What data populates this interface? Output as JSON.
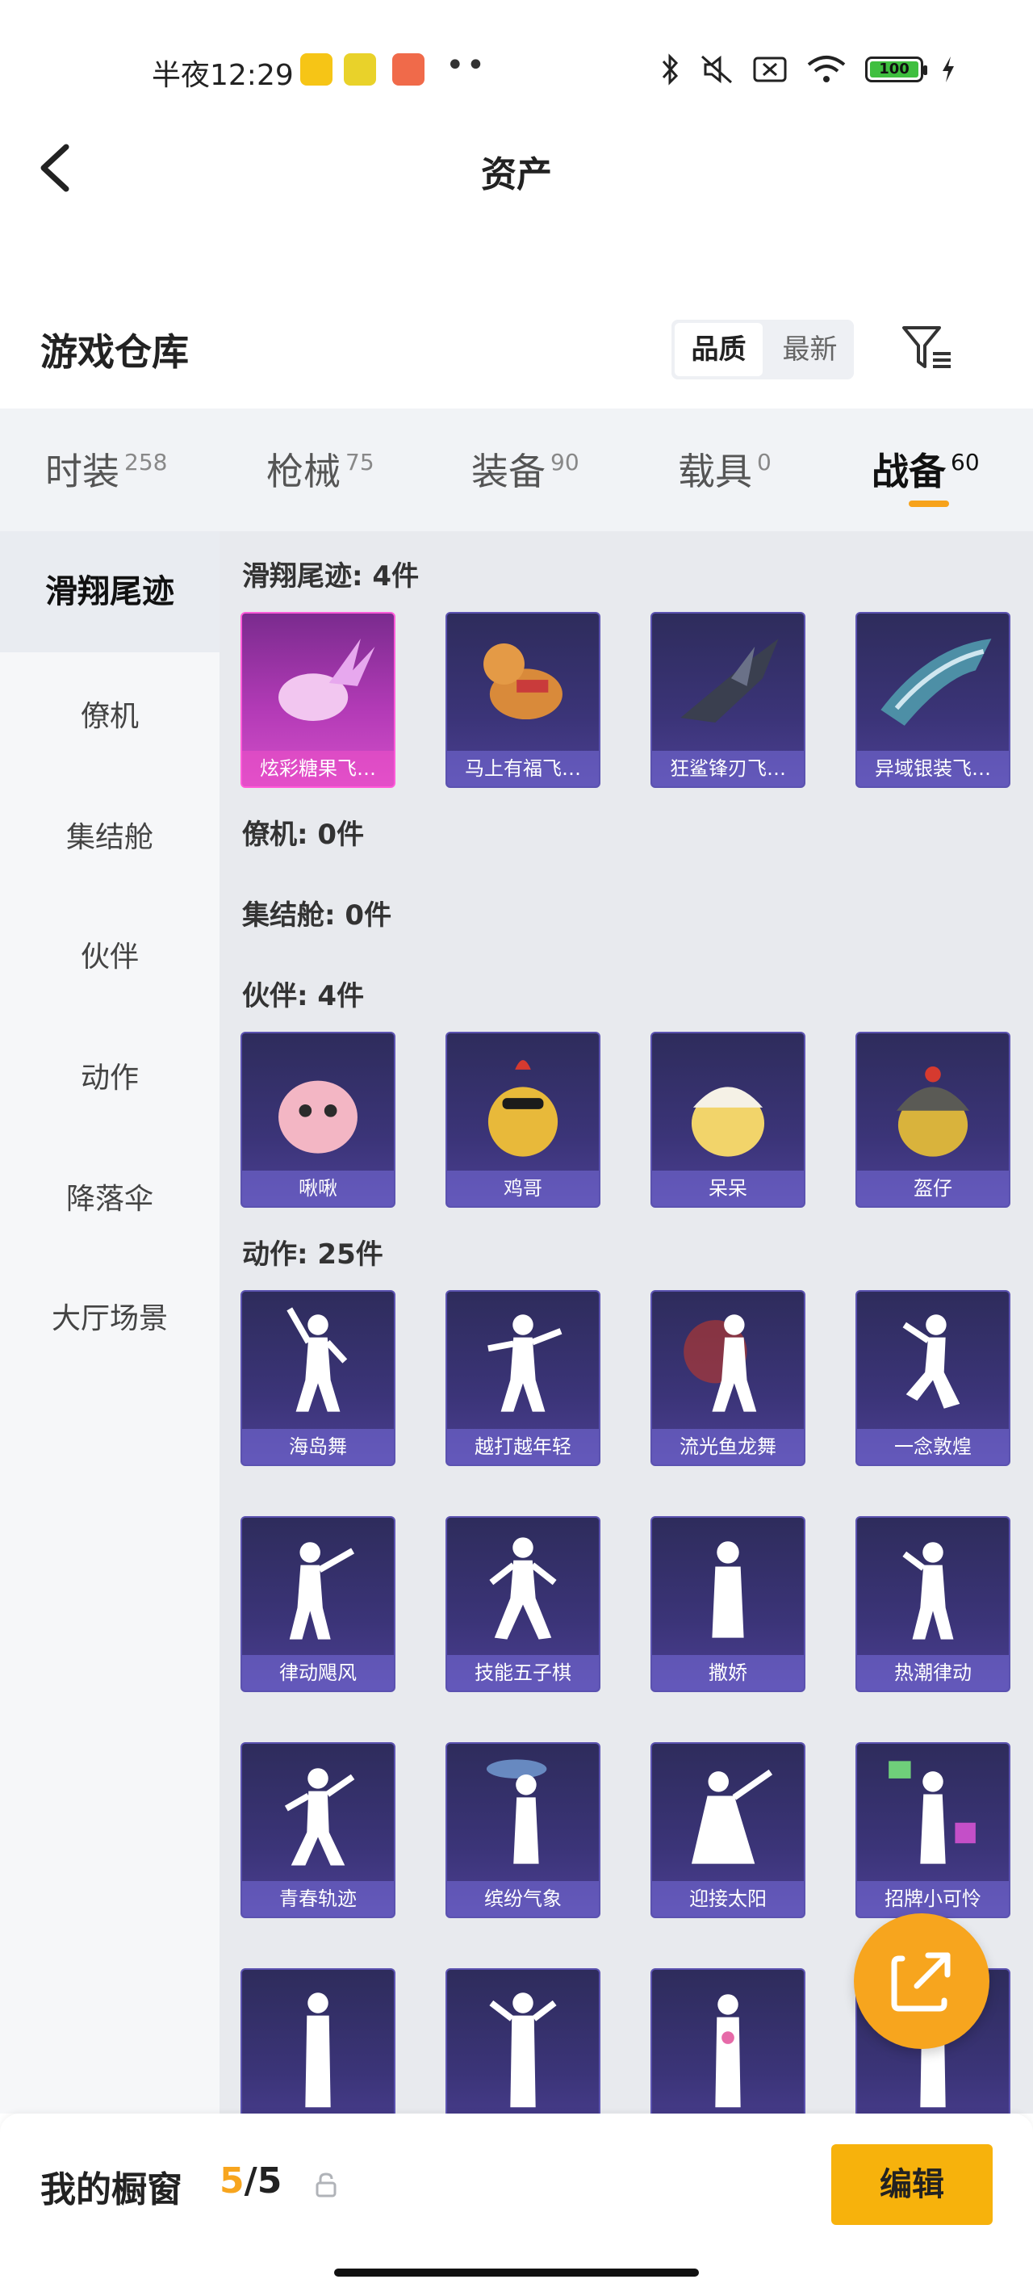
{
  "status_bar": {
    "time": "半夜12:29",
    "battery": "100"
  },
  "header": {
    "title": "资产"
  },
  "warehouse": {
    "title": "游戏仓库",
    "sort": {
      "quality": "品质",
      "newest": "最新"
    }
  },
  "tabs": [
    {
      "label": "时装",
      "count": "258"
    },
    {
      "label": "枪械",
      "count": "75"
    },
    {
      "label": "装备",
      "count": "90"
    },
    {
      "label": "载具",
      "count": "0"
    },
    {
      "label": "战备",
      "count": "60"
    }
  ],
  "sidebar": {
    "items": [
      {
        "label": "滑翔尾迹"
      },
      {
        "label": "僚机"
      },
      {
        "label": "集结舱"
      },
      {
        "label": "伙伴"
      },
      {
        "label": "动作"
      },
      {
        "label": "降落伞"
      },
      {
        "label": "大厅场景"
      }
    ]
  },
  "content": {
    "glide": {
      "title": "滑翔尾迹: 4件",
      "items": [
        "炫彩糖果飞…",
        "马上有福飞…",
        "狂鲨锋刃飞…",
        "异域银装飞…"
      ]
    },
    "wingman": {
      "title": "僚机: 0件"
    },
    "pod": {
      "title": "集结舱: 0件"
    },
    "partner": {
      "title": "伙伴: 4件",
      "items": [
        "啾啾",
        "鸡哥",
        "呆呆",
        "盔仔"
      ]
    },
    "emote": {
      "title": "动作: 25件",
      "items": [
        "海岛舞",
        "越打越年轻",
        "流光鱼龙舞",
        "一念敦煌",
        "律动飓风",
        "技能五子棋",
        "撒娇",
        "热潮律动",
        "青春轨迹",
        "缤纷气象",
        "迎接太阳",
        "招牌小可怜"
      ]
    }
  },
  "bottom": {
    "label": "我的橱窗",
    "current": "5",
    "total": "/5",
    "edit": "编辑"
  },
  "colors": {
    "accent": "#f7a51e",
    "card_bg": "#3b3478",
    "card_highlight": "#d44fc9"
  }
}
